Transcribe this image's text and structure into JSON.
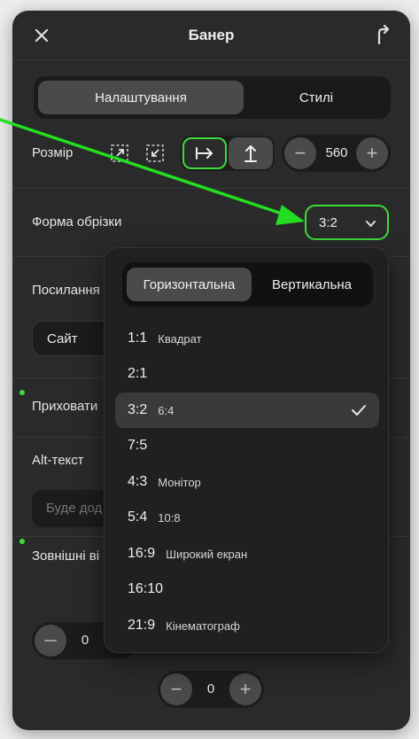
{
  "header": {
    "title": "Банер",
    "close_icon": "close-icon",
    "share_icon": "share-icon"
  },
  "tabs": {
    "settings": "Налаштування",
    "styles": "Стилі"
  },
  "size": {
    "label": "Розмір",
    "value": "560",
    "minus": "−",
    "plus": "+"
  },
  "crop": {
    "label": "Форма обрізки",
    "value": "3:2"
  },
  "link": {
    "label": "Посилання",
    "select_value": "Сайт"
  },
  "hide": {
    "label": "Приховати"
  },
  "alt": {
    "label": "Alt-текст",
    "placeholder": "Буде дод"
  },
  "margins": {
    "label": "Зовнішні ві",
    "value_left": "0",
    "value_bottom": "0"
  },
  "dropdown": {
    "tab_horizontal": "Горизонтальна",
    "tab_vertical": "Вертикальна",
    "options": [
      {
        "ratio": "1:1",
        "desc": "Квадрат"
      },
      {
        "ratio": "2:1",
        "desc": ""
      },
      {
        "ratio": "3:2",
        "desc": "6:4"
      },
      {
        "ratio": "7:5",
        "desc": ""
      },
      {
        "ratio": "4:3",
        "desc": "Монітор"
      },
      {
        "ratio": "5:4",
        "desc": "10:8"
      },
      {
        "ratio": "16:9",
        "desc": "Широкий екран"
      },
      {
        "ratio": "16:10",
        "desc": ""
      },
      {
        "ratio": "21:9",
        "desc": "Кінематограф"
      }
    ],
    "selected": "3:2"
  },
  "colors": {
    "accent": "#3cdc3c",
    "panel": "#2a2a2a",
    "dropdown": "#202020"
  }
}
